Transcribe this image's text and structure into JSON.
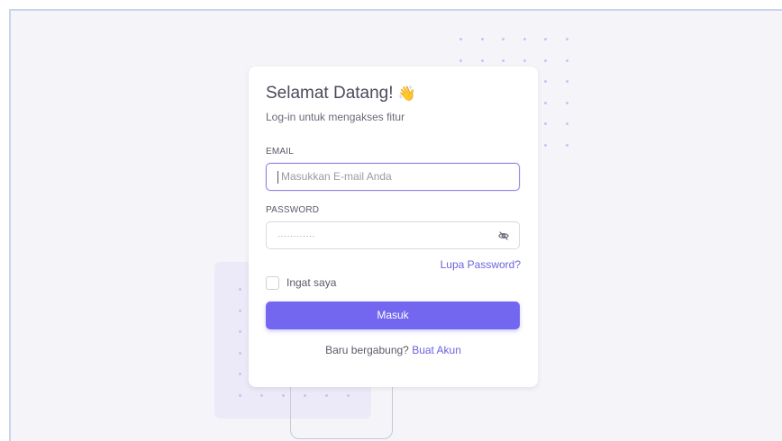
{
  "login": {
    "title": "Selamat Datang!",
    "title_emoji": "👋",
    "subtitle": "Log-in untuk mengakses fitur",
    "email_label": "EMAIL",
    "email_placeholder": "Masukkan E-mail Anda",
    "password_label": "PASSWORD",
    "password_value": "············",
    "forgot_link": "Lupa Password?",
    "remember_label": "Ingat saya",
    "submit_label": "Masuk",
    "signup_prompt": "Baru bergabung?",
    "signup_link": "Buat Akun"
  },
  "icons": {
    "password_toggle": "eye-off-icon",
    "greeting": "waving-hand-icon"
  },
  "colors": {
    "accent": "#7367f0",
    "background": "#f5f5f9",
    "card": "#ffffff",
    "frame_border": "#c9d5ea"
  }
}
